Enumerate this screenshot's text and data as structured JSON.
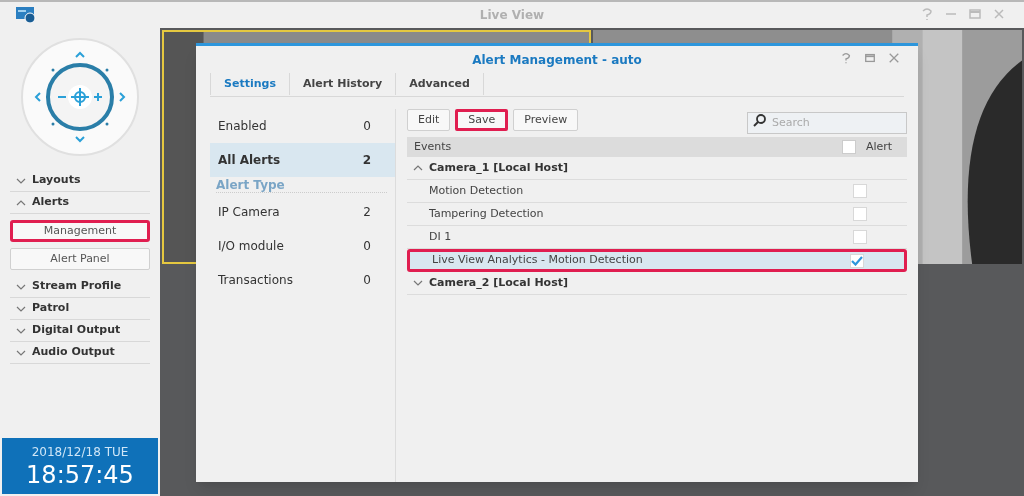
{
  "window": {
    "title": "Live View"
  },
  "sidebar": {
    "sections": [
      {
        "label": "Layouts",
        "expanded": false
      },
      {
        "label": "Alerts",
        "expanded": true,
        "buttons": [
          {
            "label": "Management",
            "highlighted": true
          },
          {
            "label": "Alert Panel",
            "highlighted": false
          }
        ]
      },
      {
        "label": "Stream Profile",
        "expanded": false
      },
      {
        "label": "Patrol",
        "expanded": false
      },
      {
        "label": "Digital Output",
        "expanded": false
      },
      {
        "label": "Audio Output",
        "expanded": false
      }
    ]
  },
  "clock": {
    "date": "2018/12/18 TUE",
    "time": "18:57:45"
  },
  "dialog": {
    "title": "Alert Management - auto",
    "tabs": [
      {
        "label": "Settings",
        "selected": true
      },
      {
        "label": "Alert History",
        "selected": false
      },
      {
        "label": "Advanced",
        "selected": false
      }
    ],
    "categories": [
      {
        "kind": "item",
        "label": "Enabled",
        "count": "0",
        "selected": false
      },
      {
        "kind": "item",
        "label": "All Alerts",
        "count": "2",
        "selected": true
      },
      {
        "kind": "heading",
        "label": "Alert Type"
      },
      {
        "kind": "item",
        "label": "IP Camera",
        "count": "2",
        "selected": false
      },
      {
        "kind": "item",
        "label": "I/O module",
        "count": "0",
        "selected": false
      },
      {
        "kind": "item",
        "label": "Transactions",
        "count": "0",
        "selected": false
      }
    ],
    "buttons": [
      {
        "label": "Edit",
        "highlighted": false
      },
      {
        "label": "Save",
        "highlighted": true
      },
      {
        "label": "Preview",
        "highlighted": false
      }
    ],
    "search": {
      "placeholder": "Search"
    },
    "table": {
      "columns": [
        "Events",
        "Alert"
      ],
      "header_checked": false,
      "groups": [
        {
          "label": "Camera_1 [Local Host]",
          "expanded": true,
          "events": [
            {
              "label": "Motion Detection",
              "checked": false,
              "selected": false,
              "highlighted": false
            },
            {
              "label": "Tampering Detection",
              "checked": false,
              "selected": false,
              "highlighted": false
            },
            {
              "label": "DI 1",
              "checked": false,
              "selected": false,
              "highlighted": false
            },
            {
              "label": "Live View Analytics - Motion Detection",
              "checked": true,
              "selected": true,
              "highlighted": true
            }
          ]
        },
        {
          "label": "Camera_2 [Local Host]",
          "expanded": false
        }
      ]
    }
  }
}
